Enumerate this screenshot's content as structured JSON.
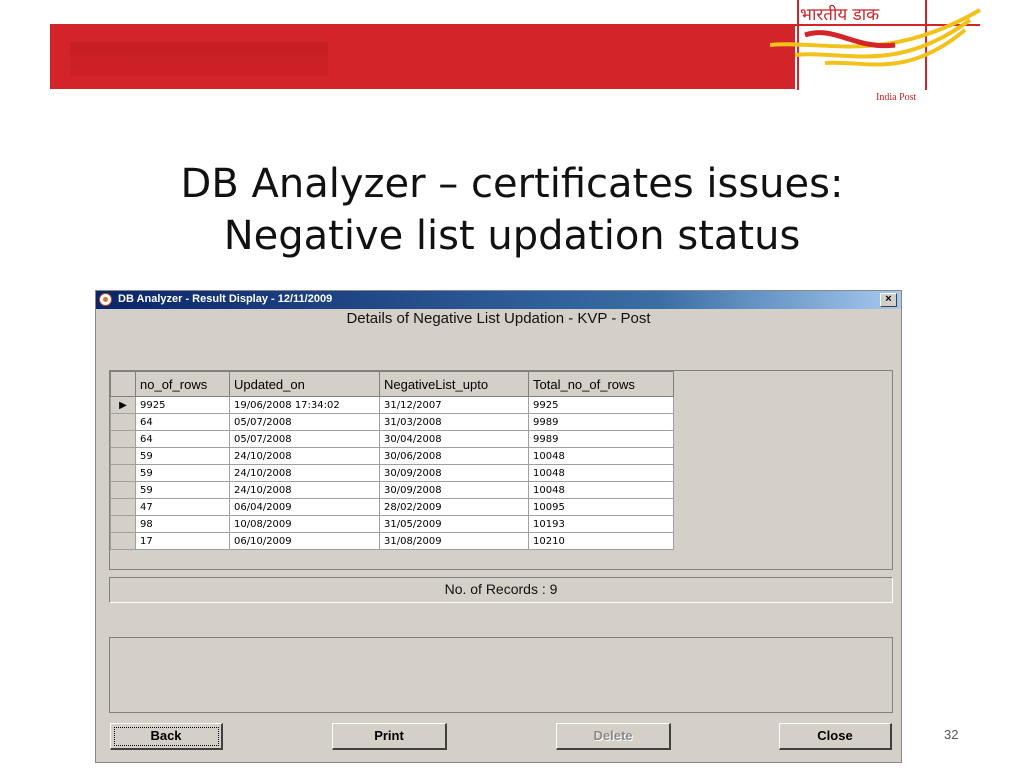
{
  "header": {
    "hindi_text": "भारतीय डाक",
    "brand_text": "India Post",
    "colors": {
      "brand_red": "#d3242a",
      "brand_yellow": "#f2c21a"
    }
  },
  "slide": {
    "title_line1": "DB Analyzer – certificates issues:",
    "title_line2": "Negative list updation status",
    "page_number": "32"
  },
  "window": {
    "title": "DB Analyzer - Result Display - 12/11/2009",
    "close_glyph": "×",
    "heading": "Details of Negative List Updation - KVP - Post",
    "columns": [
      "no_of_rows",
      "Updated_on",
      "NegativeList_upto",
      "Total_no_of_rows"
    ],
    "current_row_marker": "▶",
    "rows": [
      [
        "9925",
        "19/06/2008 17:34:02",
        "31/12/2007",
        "9925"
      ],
      [
        "64",
        "05/07/2008",
        "31/03/2008",
        "9989"
      ],
      [
        "64",
        "05/07/2008",
        "30/04/2008",
        "9989"
      ],
      [
        "59",
        "24/10/2008",
        "30/06/2008",
        "10048"
      ],
      [
        "59",
        "24/10/2008",
        "30/09/2008",
        "10048"
      ],
      [
        "59",
        "24/10/2008",
        "30/09/2008",
        "10048"
      ],
      [
        "47",
        "06/04/2009",
        "28/02/2009",
        "10095"
      ],
      [
        "98",
        "10/08/2009",
        "31/05/2009",
        "10193"
      ],
      [
        "17",
        "06/10/2009",
        "31/08/2009",
        "10210"
      ]
    ],
    "records_label": "No. of Records : 9",
    "buttons": {
      "back": "Back",
      "print": "Print",
      "delete": "Delete",
      "close": "Close"
    }
  }
}
